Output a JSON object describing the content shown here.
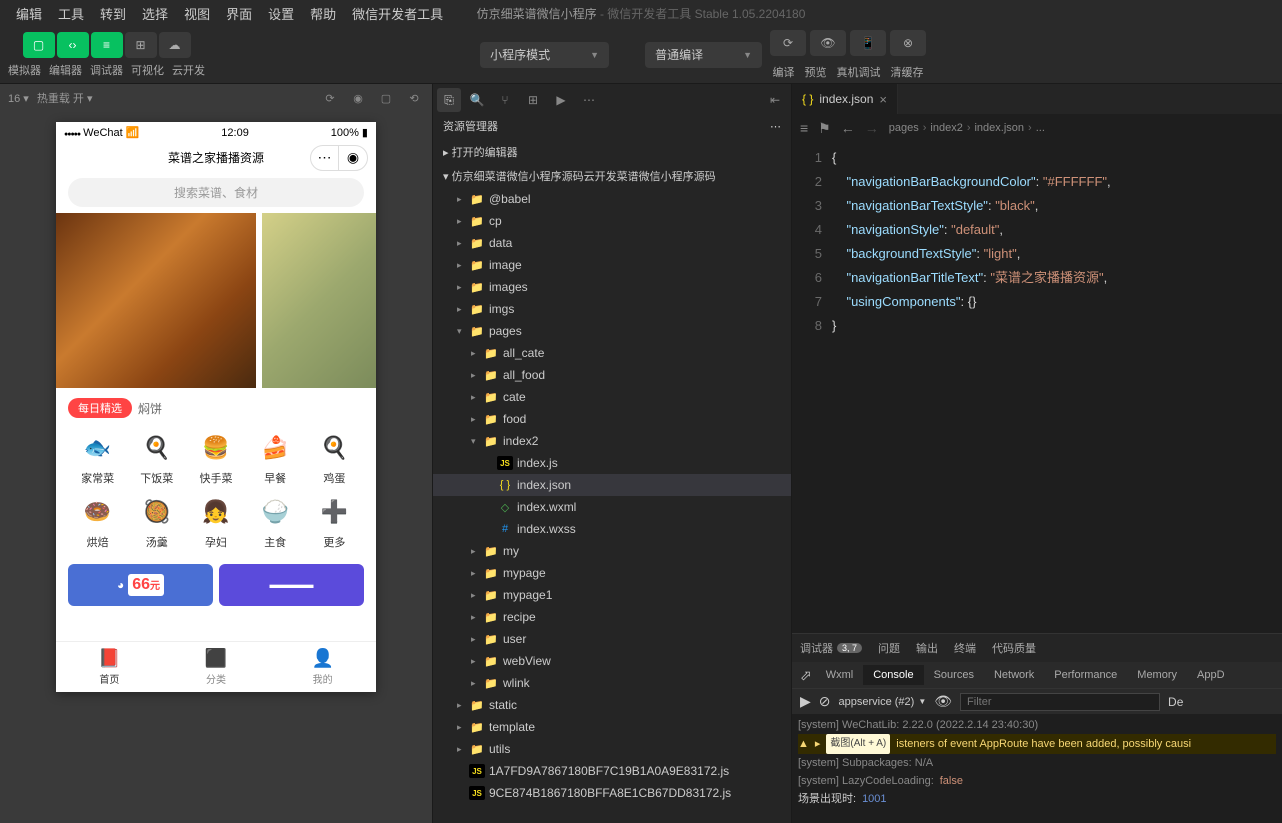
{
  "menubar": {
    "items": [
      "编辑",
      "工具",
      "转到",
      "选择",
      "视图",
      "界面",
      "设置",
      "帮助",
      "微信开发者工具"
    ]
  },
  "titlebar": {
    "project": "仿京细菜谱微信小程序",
    "sub": " - 微信开发者工具 Stable 1.05.2204180"
  },
  "toolbar": {
    "btns": [
      "模拟器",
      "编辑器",
      "调试器",
      "可视化",
      "云开发"
    ],
    "dropdown1": "小程序模式",
    "dropdown2": "普通编译",
    "actions": [
      "编译",
      "预览",
      "真机调试",
      "清缓存"
    ]
  },
  "sim": {
    "zoom": "16 ▾",
    "reload": "热重载 开 ▾",
    "statusLeft": "WeChat",
    "time": "12:09",
    "battery": "100%",
    "navTitle": "菜谱之家播播资源",
    "searchPlaceholder": "搜索菜谱、食材",
    "tagPill": "每日精选",
    "tagText": "焖饼",
    "cats": [
      "家常菜",
      "下饭菜",
      "快手菜",
      "早餐",
      "鸡蛋",
      "烘焙",
      "汤羹",
      "孕妇",
      "主食",
      "更多"
    ],
    "catIcons": [
      "🐟",
      "🍳",
      "🍔",
      "🍰",
      "🍳",
      "🍩",
      "🥘",
      "👧",
      "🍚",
      "➕"
    ],
    "bannerPrice": "66",
    "bannerUnit": "元",
    "tabs": [
      "首页",
      "分类",
      "我的"
    ],
    "tabIcons": [
      "📕",
      "⬛",
      "👤"
    ]
  },
  "explorer": {
    "header": "资源管理器",
    "section1": "打开的编辑器",
    "section2": "仿京细菜谱微信小程序源码云开发菜谱微信小程序源码",
    "tree": [
      {
        "d": 1,
        "t": "folder",
        "n": "@babel",
        "c": false
      },
      {
        "d": 1,
        "t": "folder",
        "n": "cp",
        "c": false
      },
      {
        "d": 1,
        "t": "folder",
        "n": "data",
        "c": false
      },
      {
        "d": 1,
        "t": "folder",
        "n": "image",
        "c": false
      },
      {
        "d": 1,
        "t": "folder",
        "n": "images",
        "c": false
      },
      {
        "d": 1,
        "t": "folder",
        "n": "imgs",
        "c": false
      },
      {
        "d": 1,
        "t": "folder-green",
        "n": "pages",
        "c": true,
        "open": true
      },
      {
        "d": 2,
        "t": "folder",
        "n": "all_cate",
        "c": false
      },
      {
        "d": 2,
        "t": "folder",
        "n": "all_food",
        "c": false
      },
      {
        "d": 2,
        "t": "folder",
        "n": "cate",
        "c": false
      },
      {
        "d": 2,
        "t": "folder",
        "n": "food",
        "c": false
      },
      {
        "d": 2,
        "t": "folder",
        "n": "index2",
        "c": true,
        "open": true
      },
      {
        "d": 3,
        "t": "js",
        "n": "index.js",
        "c": false
      },
      {
        "d": 3,
        "t": "json",
        "n": "index.json",
        "c": false,
        "sel": true
      },
      {
        "d": 3,
        "t": "wxml",
        "n": "index.wxml",
        "c": false
      },
      {
        "d": 3,
        "t": "wxss",
        "n": "index.wxss",
        "c": false
      },
      {
        "d": 2,
        "t": "folder",
        "n": "my",
        "c": false
      },
      {
        "d": 2,
        "t": "folder",
        "n": "mypage",
        "c": false
      },
      {
        "d": 2,
        "t": "folder",
        "n": "mypage1",
        "c": false
      },
      {
        "d": 2,
        "t": "folder",
        "n": "recipe",
        "c": false
      },
      {
        "d": 2,
        "t": "folder",
        "n": "user",
        "c": false
      },
      {
        "d": 2,
        "t": "folder",
        "n": "webView",
        "c": false
      },
      {
        "d": 2,
        "t": "folder",
        "n": "wlink",
        "c": false
      },
      {
        "d": 1,
        "t": "folder-green",
        "n": "static",
        "c": false
      },
      {
        "d": 1,
        "t": "folder",
        "n": "template",
        "c": false
      },
      {
        "d": 1,
        "t": "folder-green",
        "n": "utils",
        "c": false
      },
      {
        "d": 1,
        "t": "js",
        "n": "1A7FD9A7867180BF7C19B1A0A9E83172.js",
        "c": false
      },
      {
        "d": 1,
        "t": "js",
        "n": "9CE874B1867180BFFA8E1CB67DD83172.js",
        "c": false
      }
    ]
  },
  "editor": {
    "tabFile": "index.json",
    "breadcrumb": [
      "pages",
      "index2",
      "index.json",
      "..."
    ],
    "lines": [
      1,
      2,
      3,
      4,
      5,
      6,
      7,
      8
    ],
    "json": {
      "navigationBarBackgroundColor": "#FFFFFF",
      "navigationBarTextStyle": "black",
      "navigationStyle": "default",
      "backgroundTextStyle": "light",
      "navigationBarTitleText": "菜谱之家播播资源",
      "usingComponents": "{}"
    }
  },
  "debug": {
    "tabs": [
      "调试器",
      "问题",
      "输出",
      "终端",
      "代码质量"
    ],
    "badge": "3, 7",
    "subtabs": [
      "Wxml",
      "Console",
      "Sources",
      "Network",
      "Performance",
      "Memory",
      "AppD"
    ],
    "context": "appservice (#2)",
    "filterPlaceholder": "Filter",
    "screenshotTag": "截图(Alt + A)",
    "lines": [
      {
        "k": "sys",
        "t": "[system] WeChatLib: 2.22.0 (2022.2.14 23:40:30)"
      },
      {
        "k": "warn",
        "t": "isteners of event AppRoute have been added, possibly causi"
      },
      {
        "k": "sys",
        "t": "[system] Subpackages: N/A"
      },
      {
        "k": "sys",
        "t": "[system] LazyCodeLoading: "
      },
      {
        "k": "plain",
        "t": "场景出现时:   "
      }
    ],
    "lazyVal": "false",
    "sceneVal": "1001",
    "defaultLabel": "De"
  }
}
